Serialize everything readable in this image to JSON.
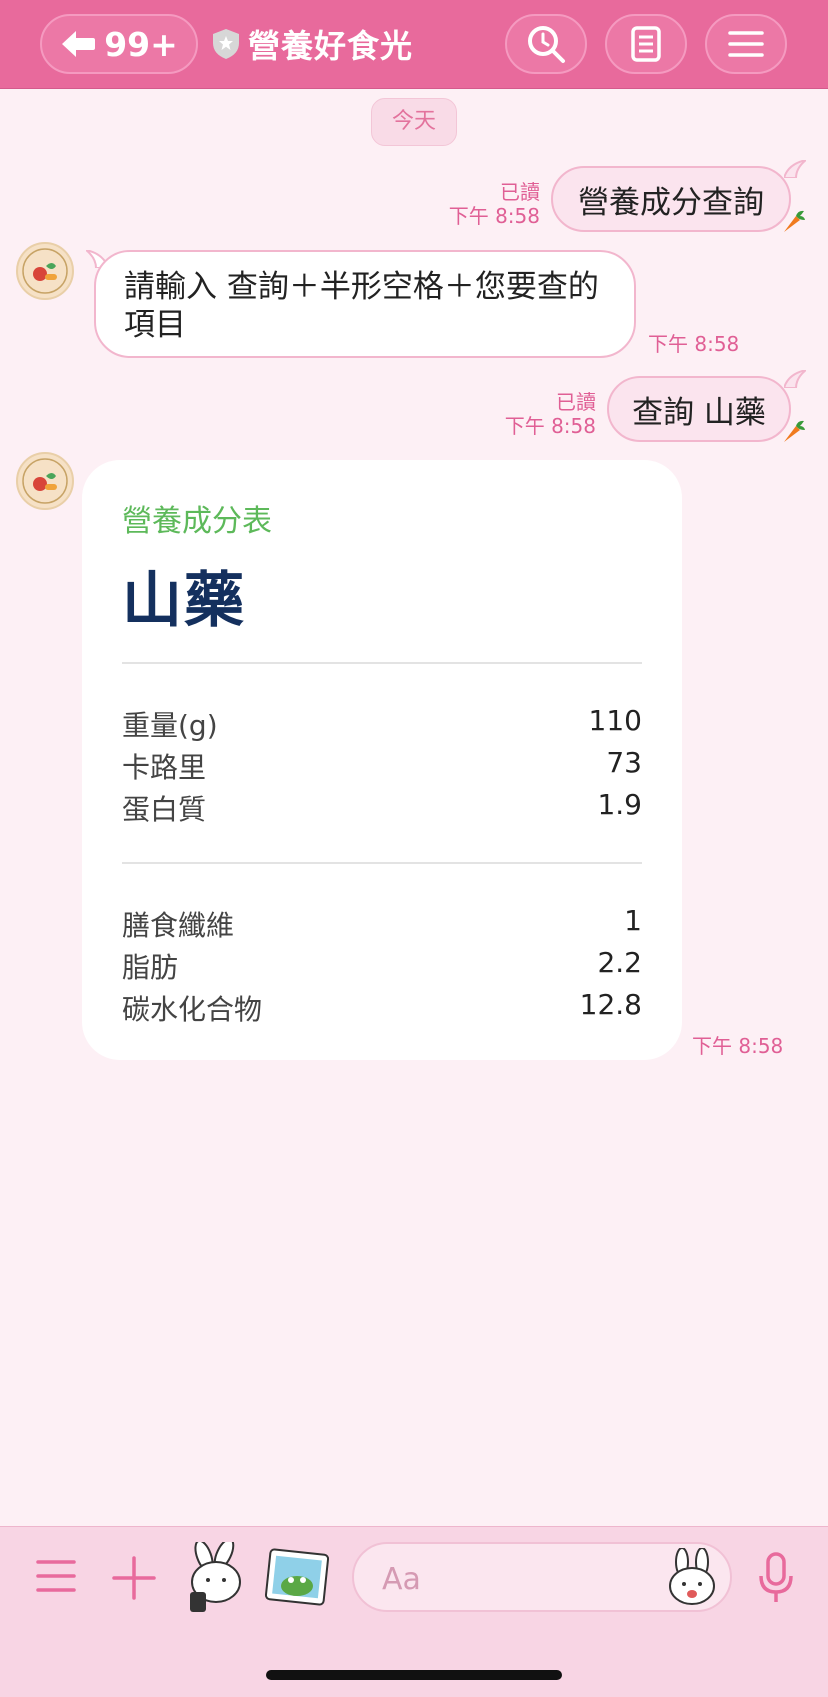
{
  "header": {
    "unread_count": "99+",
    "chat_name": "營養好食光"
  },
  "date_label": "今天",
  "messages": [
    {
      "direction": "out",
      "read": "已讀",
      "time": "下午 8:58",
      "text": "營養成分查詢"
    },
    {
      "direction": "in",
      "time": "下午 8:58",
      "line1": "請輸入 查詢＋半形空格＋您要查的",
      "line2": "項目"
    },
    {
      "direction": "out",
      "read": "已讀",
      "time": "下午 8:58",
      "text": "查詢 山藥"
    },
    {
      "direction": "in",
      "time": "下午 8:58"
    }
  ],
  "nutrition_card": {
    "kicker": "營養成分表",
    "food": "山藥",
    "group1": [
      {
        "label": "重量(g)",
        "value": "110"
      },
      {
        "label": "卡路里",
        "value": "73"
      },
      {
        "label": "蛋白質",
        "value": "1.9"
      }
    ],
    "group2": [
      {
        "label": "膳食纖維",
        "value": "1"
      },
      {
        "label": "脂肪",
        "value": "2.2"
      },
      {
        "label": "碳水化合物",
        "value": "12.8"
      }
    ]
  },
  "composer": {
    "placeholder": "Aa"
  },
  "icons": {
    "back": "arrow-left-icon",
    "verified": "shield-star-icon",
    "search": "search-icon",
    "notes": "notes-icon",
    "menu": "hamburger-icon",
    "carrot": "carrot-icon",
    "mic": "mic-icon",
    "plus": "plus-icon"
  },
  "colors": {
    "header_bg": "#e86a9c",
    "accent": "#e05f95",
    "card_kicker": "#5db95a",
    "card_food": "#14305e"
  }
}
